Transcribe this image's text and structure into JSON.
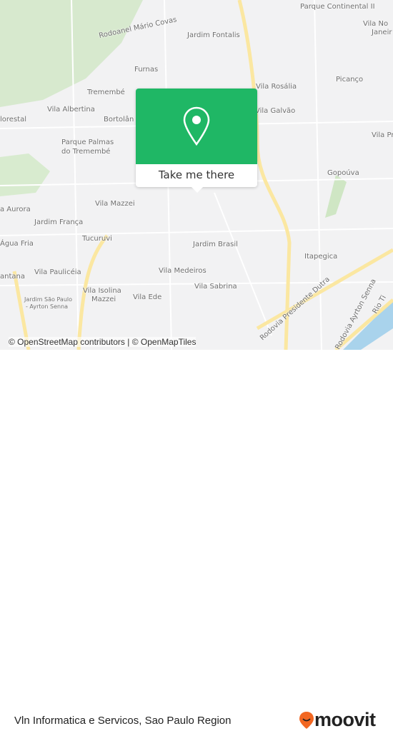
{
  "map": {
    "labels": [
      "Parque Continental II",
      "Vila No",
      "Janeir",
      "Rodoanel Mário Covas",
      "Jardim Fontalis",
      "Furnas",
      "Picanço",
      "Tremembé",
      "Vila Rosália",
      "Vila Albertina",
      "Bortolân",
      "Vila Galvão",
      "lorestal",
      "Vila Pr",
      "Parque Palmas",
      "do Tremembé",
      "Gopoúva",
      "Vila Mazzei",
      "a Aurora",
      "Jardim França",
      "Tucuruvi",
      "Água Fria",
      "Jardim Brasil",
      "Itapegica",
      "antana",
      "Vila Paulicéia",
      "Vila Medeiros",
      "Vila Sabrina",
      "Vila Isolina",
      "Mazzei",
      "Vila Ede",
      "Jardim São Paulo",
      "- Ayrton Senna",
      "Rodovia Presidente Dutra",
      "Rodovia Ayrton Senna",
      "Rio Ti"
    ],
    "attribution": "© OpenStreetMap contributors | © OpenMapTiles",
    "colors": {
      "park": "#cfe6c4",
      "major_road": "#fbe7a1",
      "water": "#a9d3ec"
    }
  },
  "popup": {
    "button_label": "Take me there",
    "icon": "map-pin-icon",
    "color": "#1fb765"
  },
  "footer": {
    "title": "Vln Informatica e Servicos, Sao Paulo Region",
    "brand": "moovit",
    "brand_color": "#f26722"
  }
}
